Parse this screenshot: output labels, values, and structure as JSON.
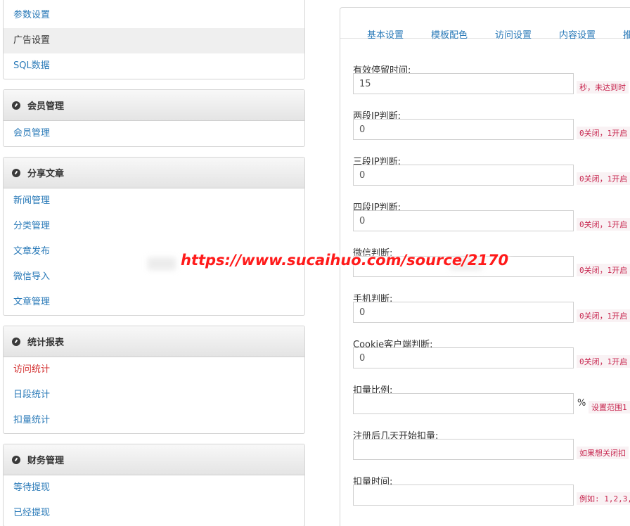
{
  "sidebar": {
    "top_items": [
      {
        "label": "参数设置"
      },
      {
        "label": "广告设置"
      },
      {
        "label": "SQL数据"
      }
    ],
    "sections": [
      {
        "title": "会员管理",
        "icon": "dashboard-icon",
        "items": [
          {
            "label": "会员管理"
          }
        ]
      },
      {
        "title": "分享文章",
        "icon": "dashboard-icon",
        "items": [
          {
            "label": "新闻管理"
          },
          {
            "label": "分类管理"
          },
          {
            "label": "文章发布"
          },
          {
            "label": "微信导入"
          },
          {
            "label": "文章管理"
          }
        ]
      },
      {
        "title": "统计报表",
        "icon": "dashboard-icon",
        "items": [
          {
            "label": "访问统计"
          },
          {
            "label": "日段统计"
          },
          {
            "label": "扣量统计"
          }
        ]
      },
      {
        "title": "财务管理",
        "icon": "dashboard-icon",
        "items": [
          {
            "label": "等待提现"
          },
          {
            "label": "已经提现"
          }
        ]
      }
    ]
  },
  "tabs": [
    "基本设置",
    "模板配色",
    "访问设置",
    "内容设置",
    "推"
  ],
  "form": [
    {
      "label": "有效停留时间:",
      "value": "15",
      "hint": "秒，未达到时"
    },
    {
      "label": "两段IP判断:",
      "value": "0",
      "hint": "0关闭，1开启"
    },
    {
      "label": "三段IP判断:",
      "value": "0",
      "hint": "0关闭，1开启"
    },
    {
      "label": "四段IP判断:",
      "value": "0",
      "hint": "0关闭，1开启"
    },
    {
      "label": "微信判断:",
      "value": "",
      "hint": "0关闭，1开启"
    },
    {
      "label": "手机判断:",
      "value": "0",
      "hint": "0关闭，1开启"
    },
    {
      "label": "Cookie客户端判断:",
      "value": "0",
      "hint": "0关闭，1开启"
    },
    {
      "label": "扣量比例:",
      "value": "",
      "unit": "%",
      "hint": "设置范围1"
    },
    {
      "label": "注册后几天开始扣量:",
      "value": "",
      "hint": "如果想关闭扣"
    },
    {
      "label": "扣量时间:",
      "value": "",
      "hint": "例如: 1,2,3,"
    }
  ],
  "watermark": "https://www.sucaihuo.com/source/2170",
  "colors": {
    "link": "#2a7ab8",
    "active_link": "#d33030",
    "hint": "#c7254e",
    "watermark": "#ff1a1a"
  }
}
